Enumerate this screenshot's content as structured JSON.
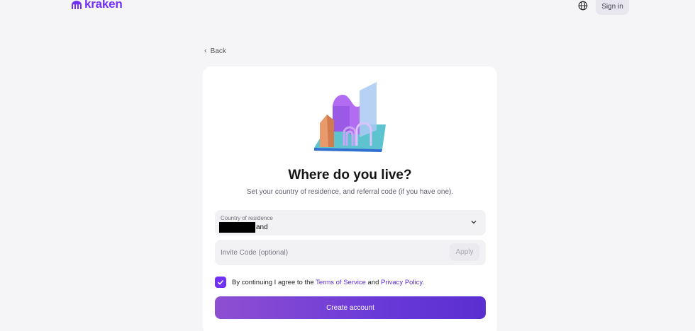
{
  "brand": {
    "name": "kraken",
    "color": "#7132f5"
  },
  "header": {
    "language_icon": "globe-icon",
    "signin_label": "Sign in"
  },
  "nav": {
    "back_label": "Back"
  },
  "form": {
    "title": "Where do you live?",
    "subtitle": "Set your country of residence, and referral code (if you have one).",
    "country": {
      "label": "Country of residence",
      "value_visible_part": "and",
      "redacted": true
    },
    "invite": {
      "placeholder": "Invite Code (optional)",
      "value": "",
      "apply_label": "Apply"
    },
    "consent": {
      "checked": true,
      "prefix": "By continuing I agree to the ",
      "terms_link": "Terms of Service",
      "middle": " and ",
      "privacy_link": "Privacy Policy",
      "suffix": "."
    },
    "submit_label": "Create account"
  }
}
